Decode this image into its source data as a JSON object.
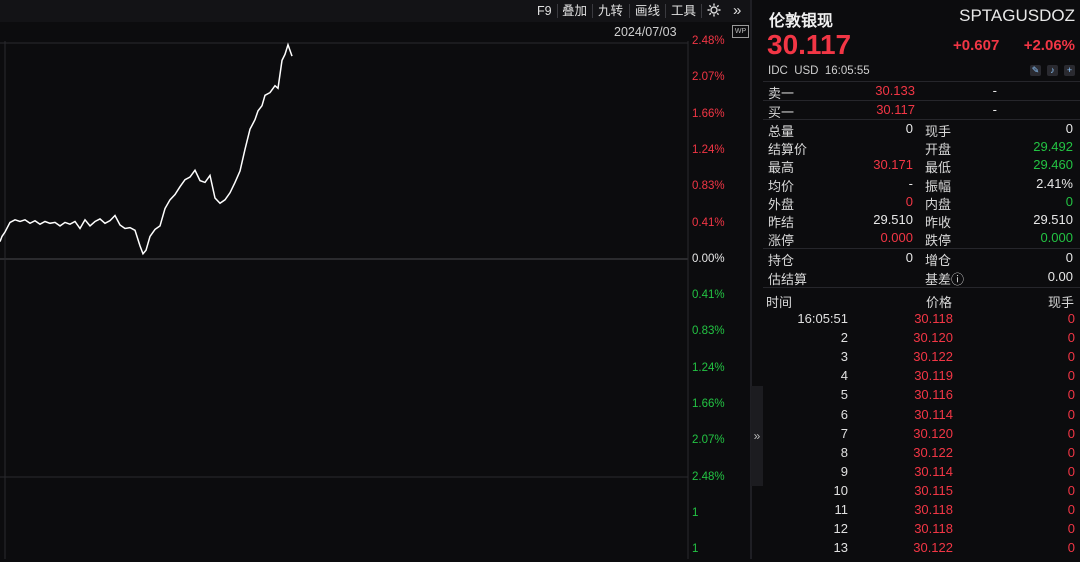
{
  "toolbar": {
    "f9": "F9",
    "overlay": "叠加",
    "nine_turn": "九转",
    "draw_line": "画线",
    "tools": "工具",
    "more": "»"
  },
  "chart": {
    "date": "2024/07/03",
    "wp_badge": "WP",
    "y_labels": [
      "2.48%",
      "2.07%",
      "1.66%",
      "1.24%",
      "0.83%",
      "0.41%",
      "0.00%",
      "0.41%",
      "0.83%",
      "1.24%",
      "1.66%",
      "2.07%",
      "2.48%",
      "1",
      "1"
    ],
    "y_label_colors": [
      "red",
      "red",
      "red",
      "red",
      "red",
      "red",
      "white",
      "green",
      "green",
      "green",
      "green",
      "green",
      "green",
      "green",
      "green"
    ],
    "series_colors": {
      "line": "#ffffff",
      "up": "#f23645",
      "down": "#23c343"
    }
  },
  "chart_data": {
    "type": "line",
    "title": "",
    "xlabel": "2024/07/03",
    "ylabel": "",
    "ylim": [
      -2.48,
      2.48
    ],
    "y_ticks": [
      "2.48%",
      "2.07%",
      "1.66%",
      "1.24%",
      "0.83%",
      "0.41%",
      "0.00%",
      "0.41%",
      "0.83%",
      "1.24%",
      "1.66%",
      "2.07%",
      "2.48%"
    ],
    "x": [
      0,
      2,
      5,
      10,
      15,
      20,
      25,
      30,
      35,
      40,
      45,
      50,
      55,
      60,
      65,
      70,
      75,
      80,
      85,
      90,
      95,
      100,
      105,
      110,
      115,
      120,
      125,
      130,
      135,
      140,
      143,
      146,
      150,
      155,
      160,
      165,
      170,
      175,
      180,
      185,
      190,
      195,
      200,
      205,
      210,
      215,
      220,
      225,
      230,
      235,
      240,
      245,
      250,
      255,
      258,
      262,
      265,
      270,
      275,
      278,
      282,
      285,
      288,
      292
    ],
    "values": [
      0.2,
      0.26,
      0.31,
      0.42,
      0.45,
      0.43,
      0.45,
      0.41,
      0.44,
      0.4,
      0.43,
      0.41,
      0.42,
      0.38,
      0.42,
      0.4,
      0.43,
      0.35,
      0.45,
      0.38,
      0.43,
      0.46,
      0.41,
      0.44,
      0.5,
      0.39,
      0.35,
      0.36,
      0.33,
      0.15,
      0.06,
      0.1,
      0.26,
      0.34,
      0.38,
      0.58,
      0.68,
      0.74,
      0.83,
      0.91,
      0.94,
      1.02,
      0.9,
      0.88,
      0.96,
      0.7,
      0.64,
      0.68,
      0.76,
      0.88,
      1.01,
      1.26,
      1.49,
      1.6,
      1.7,
      1.76,
      1.88,
      1.91,
      1.99,
      1.96,
      2.28,
      2.35,
      2.46,
      2.33
    ]
  },
  "quote": {
    "name": "伦敦银现",
    "symbol": "SPTAGUSDOZ",
    "price": "30.117",
    "change": "+0.607",
    "change_pct": "+2.06%",
    "market": "IDC",
    "currency": "USD",
    "time": "16:05:55",
    "sell1_label": "卖一",
    "sell1_price": "30.133",
    "sell1_vol": "-",
    "buy1_label": "买一",
    "buy1_price": "30.117",
    "buy1_vol": "-",
    "stats": [
      {
        "l1": "总量",
        "v1": "0",
        "c1": "white",
        "l2": "现手",
        "v2": "0",
        "c2": "white"
      },
      {
        "l1": "结算价",
        "v1": "",
        "c1": "white",
        "l2": "开盘",
        "v2": "29.492",
        "c2": "green"
      },
      {
        "l1": "最高",
        "v1": "30.171",
        "c1": "red",
        "l2": "最低",
        "v2": "29.460",
        "c2": "green"
      },
      {
        "l1": "均价",
        "v1": "-",
        "c1": "white",
        "l2": "振幅",
        "v2": "2.41%",
        "c2": "white"
      },
      {
        "l1": "外盘",
        "v1": "0",
        "c1": "red",
        "l2": "内盘",
        "v2": "0",
        "c2": "green"
      },
      {
        "l1": "昨结",
        "v1": "29.510",
        "c1": "white",
        "l2": "昨收",
        "v2": "29.510",
        "c2": "white"
      },
      {
        "l1": "涨停",
        "v1": "0.000",
        "c1": "red",
        "l2": "跌停",
        "v2": "0.000",
        "c2": "green"
      }
    ],
    "stats2": [
      {
        "l1": "持仓",
        "v1": "0",
        "l2": "增仓",
        "v2": "0"
      },
      {
        "l1": "估结算",
        "v1": "",
        "l2": "基差ⓘ",
        "v2": "0.00"
      }
    ]
  },
  "ticks": {
    "headers": {
      "time": "时间",
      "price": "价格",
      "vol": "现手"
    },
    "rows": [
      {
        "time": "16:05:51",
        "price": "30.118",
        "vol": "0"
      },
      {
        "time": "2",
        "price": "30.120",
        "vol": "0"
      },
      {
        "time": "3",
        "price": "30.122",
        "vol": "0"
      },
      {
        "time": "4",
        "price": "30.119",
        "vol": "0"
      },
      {
        "time": "5",
        "price": "30.116",
        "vol": "0"
      },
      {
        "time": "6",
        "price": "30.114",
        "vol": "0"
      },
      {
        "time": "7",
        "price": "30.120",
        "vol": "0"
      },
      {
        "time": "8",
        "price": "30.122",
        "vol": "0"
      },
      {
        "time": "9",
        "price": "30.114",
        "vol": "0"
      },
      {
        "time": "10",
        "price": "30.115",
        "vol": "0"
      },
      {
        "time": "11",
        "price": "30.118",
        "vol": "0"
      },
      {
        "time": "12",
        "price": "30.118",
        "vol": "0"
      },
      {
        "time": "13",
        "price": "30.122",
        "vol": "0"
      }
    ]
  }
}
